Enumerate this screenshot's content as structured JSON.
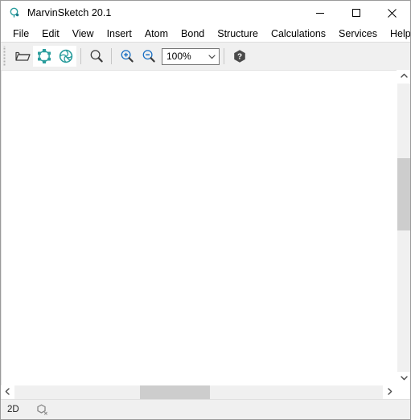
{
  "window": {
    "title": "MarvinSketch 20.1",
    "app_icon": "molecule-icon",
    "controls": {
      "minimize": "minimize-icon",
      "maximize": "maximize-icon",
      "close": "close-icon"
    }
  },
  "menubar": {
    "items": [
      {
        "label": "File"
      },
      {
        "label": "Edit"
      },
      {
        "label": "View"
      },
      {
        "label": "Insert"
      },
      {
        "label": "Atom"
      },
      {
        "label": "Bond"
      },
      {
        "label": "Structure"
      },
      {
        "label": "Calculations"
      },
      {
        "label": "Services"
      },
      {
        "label": "Help"
      }
    ]
  },
  "toolbar": {
    "open_icon": "open-folder-icon",
    "clean2d_icon": "clean-2d-molecule-icon",
    "clean3d_icon": "clean-3d-molecule-icon",
    "search_icon": "magnifier-icon",
    "zoom_in_icon": "zoom-in-icon",
    "zoom_out_icon": "zoom-out-icon",
    "zoom_level": "100%",
    "zoom_dropdown_arrow": "chevron-down-icon",
    "help_icon": "help-hexagon-icon"
  },
  "canvas": {
    "background_color": "#ffffff"
  },
  "scrollbars": {
    "vertical": {
      "up_arrow": "chevron-up-icon",
      "down_arrow": "chevron-down-icon",
      "thumb_top_percent": 26,
      "thumb_height_percent": 25
    },
    "horizontal": {
      "left_arrow": "chevron-left-icon",
      "right_arrow": "chevron-right-icon",
      "thumb_left_percent": 34,
      "thumb_width_percent": 19
    }
  },
  "statusbar": {
    "dimension_mode": "2D",
    "chirality_icon": "molecule-chirality-icon"
  },
  "colors": {
    "accent_teal": "#2a9d9d",
    "accent_blue": "#1a6fc4",
    "window_chrome": "#f0f0f0",
    "scroll_thumb": "#cdcdcd",
    "help_dark": "#4a4a4a"
  }
}
